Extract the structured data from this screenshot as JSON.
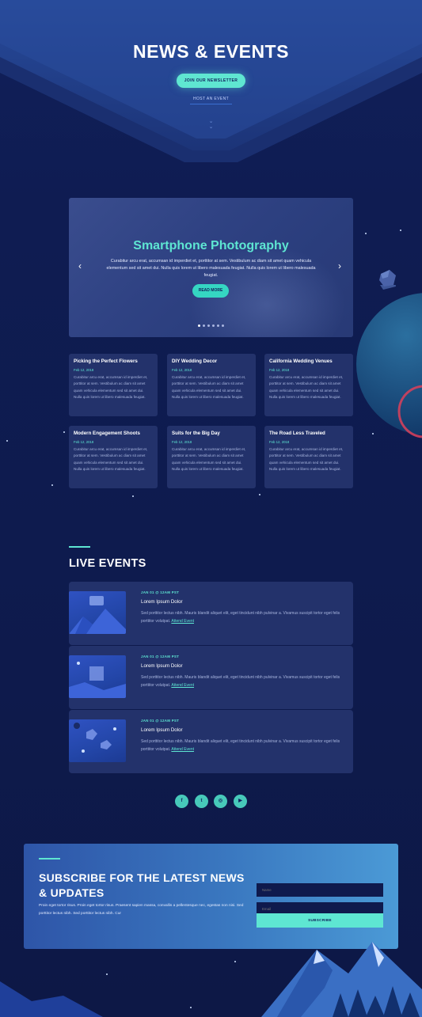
{
  "hero": {
    "title": "NEWS & EVENTS",
    "newsletter_button": "JOIN OUR NEWSLETTER",
    "host_link": "HOST AN EVENT",
    "scroll_icon": "chevron-double-down-icon"
  },
  "slider": {
    "title": "Smartphone Photography",
    "text": "Curabitur arcu erat, accumsan id imperdiet et, porttitor at sem. Vestibulum ac diam sit amet quam vehicula elementum sed sit amet dui. Nulla quis lorem ut libero malesuada feugiat. Nulla quis lorem ut libero malesuada feugiat.",
    "button": "READ MORE",
    "prev_icon": "chevron-left-icon",
    "next_icon": "chevron-right-icon",
    "slide_count": 6,
    "active_slide": 1
  },
  "posts": [
    {
      "title": "Picking the Perfect Flowers",
      "date": "Feb 12, 2018",
      "text": "Curabitur arcu erat, accumsan id imperdiet et, porttitor at sem. Vestibulum ac diam sit amet quam vehicula elementum sed sit amet dui. Nulla quis lorem ut libero malesuada feugiat."
    },
    {
      "title": "DIY Wedding Decor",
      "date": "Feb 12, 2018",
      "text": "Curabitur arcu erat, accumsan id imperdiet et, porttitor at sem. Vestibulum ac diam sit amet quam vehicula elementum sed sit amet dui. Nulla quis lorem ut libero malesuada feugiat."
    },
    {
      "title": "California Wedding Venues",
      "date": "Feb 12, 2018",
      "text": "Curabitur arcu erat, accumsan id imperdiet et, porttitor at sem. Vestibulum ac diam sit amet quam vehicula elementum sed sit amet dui. Nulla quis lorem ut libero malesuada feugiat."
    },
    {
      "title": "Modern Engagement Shoots",
      "date": "Feb 12, 2018",
      "text": "Curabitur arcu erat, accumsan id imperdiet et, porttitor at sem. Vestibulum ac diam sit amet quam vehicula elementum sed sit amet dui. Nulla quis lorem ut libero malesuada feugiat."
    },
    {
      "title": "Suits for the Big Day",
      "date": "Feb 12, 2018",
      "text": "Curabitur arcu erat, accumsan id imperdiet et, porttitor at sem. Vestibulum ac diam sit amet quam vehicula elementum sed sit amet dui. Nulla quis lorem ut libero malesuada feugiat."
    },
    {
      "title": "The Road Less Traveled",
      "date": "Feb 12, 2018",
      "text": "Curabitur arcu erat, accumsan id imperdiet et, porttitor at sem. Vestibulum ac diam sit amet quam vehicula elementum sed sit amet dui. Nulla quis lorem ut libero malesuada feugiat."
    }
  ],
  "live": {
    "title": "LIVE EVENTS",
    "events": [
      {
        "date": "JAN 01 @ 12AM PST",
        "title": "Lorem Ipsum Dolor",
        "text": "Sed porttitor lectus nibh. Mauris blandit aliquet elit, eget tincidunt nibh pulvinar a. Vivamus suscipit tortor eget felis porttitor volutpat.",
        "link": "Attend Event"
      },
      {
        "date": "JAN 01 @ 12AM PST",
        "title": "Lorem Ipsum Dolor",
        "text": "Sed porttitor lectus nibh. Mauris blandit aliquet elit, eget tincidunt nibh pulvinar a. Vivamus suscipit tortor eget felis porttitor volutpat.",
        "link": "Attend Event"
      },
      {
        "date": "JAN 01 @ 12AM PST",
        "title": "Lorem Ipsum Dolor",
        "text": "Sed porttitor lectus nibh. Mauris blandit aliquet elit, eget tincidunt nibh pulvinar a. Vivamus suscipit tortor eget felis porttitor volutpat.",
        "link": "Attend Event"
      }
    ]
  },
  "social": {
    "facebook": "f",
    "twitter": "t",
    "instagram": "◎",
    "youtube": "▶",
    "icons": [
      "facebook-icon",
      "twitter-icon",
      "instagram-icon",
      "youtube-icon"
    ]
  },
  "subscribe": {
    "title": "SUBSCRIBE FOR THE LATEST NEWS & UPDATES",
    "text": "Proin eget tortor risus. Proin eget tortor risus. Praesent sapien massa, convallis a pellentesque nec, egestas non nisi. Sed porttitor lectus nibh. Sed porttitor lectus nibh. Cur",
    "name_placeholder": "Name",
    "email_placeholder": "Email",
    "button": "SUBSCRIBE"
  },
  "colors": {
    "accent": "#5ee6d2",
    "background": "#0e1b4e",
    "card": "#23326b"
  }
}
